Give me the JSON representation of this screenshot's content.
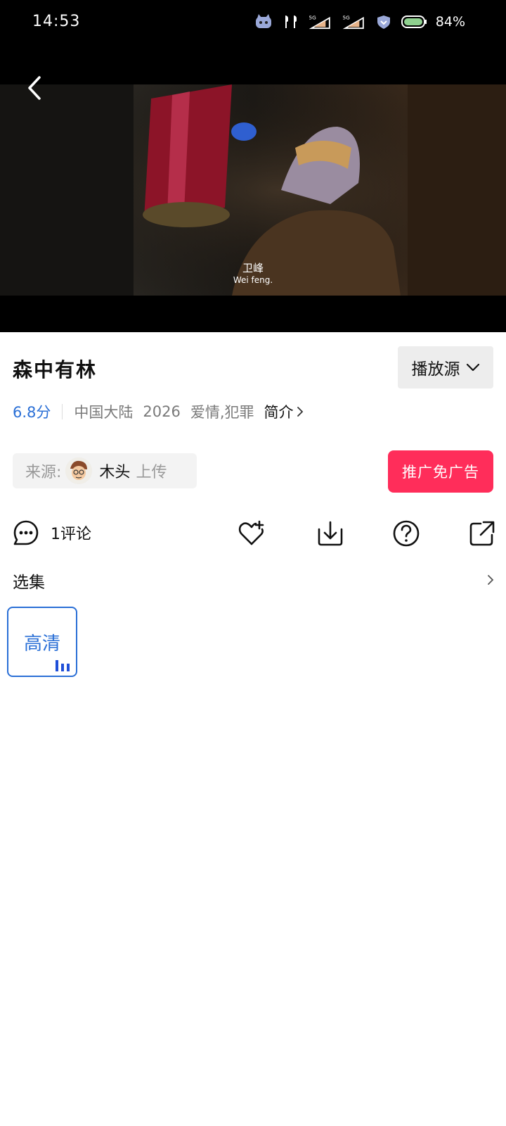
{
  "status_bar": {
    "time": "14:53",
    "battery": "84%",
    "icons": [
      "app-cat-icon",
      "earbuds-icon",
      "signal-5g-icon",
      "signal-5g-icon",
      "vpn-shield-icon",
      "battery-icon"
    ]
  },
  "video": {
    "subtitle_cn": "卫峰",
    "subtitle_en": "Wei feng."
  },
  "title": "森中有林",
  "source_button": "播放源",
  "meta": {
    "score": "6.8分",
    "region": "中国大陆",
    "year": "2026",
    "genres": "爱情,犯罪",
    "intro": "简介"
  },
  "uploader": {
    "label": "来源:",
    "name": "木头",
    "action": "上传"
  },
  "promo_button": "推广免广告",
  "actions": {
    "comment_count": "1评论"
  },
  "episodes": {
    "title": "选集",
    "items": [
      "高清"
    ]
  },
  "colors": {
    "accent_blue": "#2a6fd6",
    "promo_red": "#ff2d5a"
  }
}
